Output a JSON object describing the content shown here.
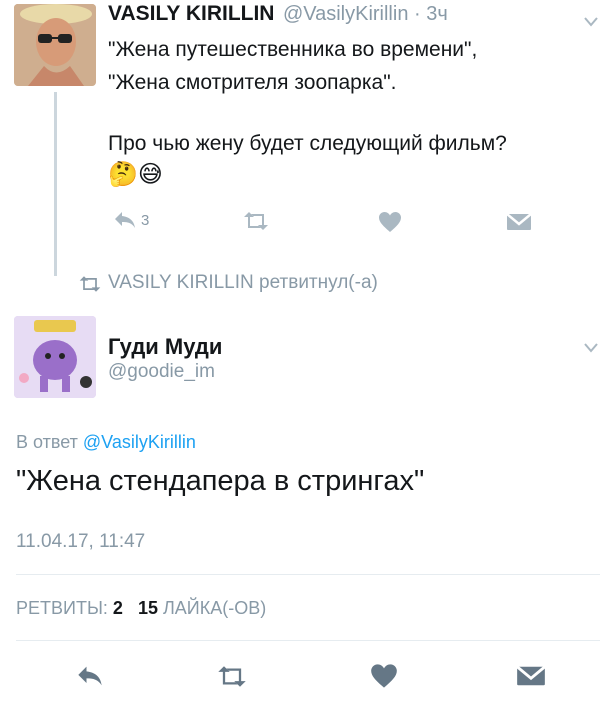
{
  "first_tweet": {
    "author_name": "VASILY KIRILLIN",
    "handle_time": "@VasilyKirillin · 3ч",
    "text_line1": "\"Жена путешественника во времени\",",
    "text_line2": "\"Жена смотрителя зоопарка\".",
    "text_line3": "Про чью жену будет следующий фильм?",
    "emoji": "🤔😅",
    "reply_count": "3"
  },
  "retweet_banner": {
    "label": "VASILY KIRILLIN ретвитнул(-а)"
  },
  "main_tweet": {
    "author_name": "Гуди Муди",
    "handle": "@goodie_im",
    "reply_prefix": "В ответ ",
    "reply_to": "@VasilyKirillin",
    "text": "\"Жена стендапера в стрингах\"",
    "timestamp": "11.04.17, 11:47",
    "retweets_label": "РЕТВИТЫ:",
    "retweets_count": "2",
    "likes_count": "15",
    "likes_label": "ЛАЙКА(-ОВ)"
  },
  "colors": {
    "accent": "#1da1f2",
    "muted": "#8899a6",
    "icon": "#657786",
    "heart": "#8899a6"
  },
  "icons": [
    "reply-icon",
    "retweet-icon",
    "like-icon",
    "direct-message-icon",
    "chevron-down-icon"
  ]
}
